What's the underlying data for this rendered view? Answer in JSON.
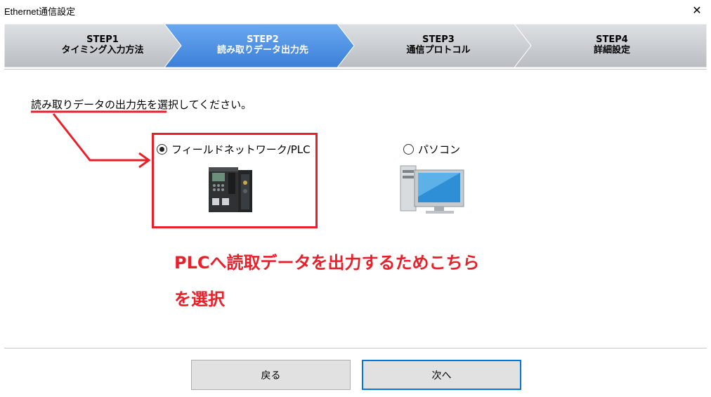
{
  "window": {
    "title": "Ethernet通信設定",
    "close_glyph": "✕"
  },
  "steps": [
    {
      "line1": "STEP1",
      "line2": "タイミング入力方法",
      "active": false
    },
    {
      "line1": "STEP2",
      "line2": "読み取りデータ出力先",
      "active": true
    },
    {
      "line1": "STEP3",
      "line2": "通信プロトコル",
      "active": false
    },
    {
      "line1": "STEP4",
      "line2": "詳細設定",
      "active": false
    }
  ],
  "instruction": "読み取りデータの出力先を選択してください。",
  "options": [
    {
      "label": "フィールドネットワーク/PLC",
      "selected": true,
      "icon": "plc-device-icon"
    },
    {
      "label": "パソコン",
      "selected": false,
      "icon": "desktop-pc-icon"
    }
  ],
  "annotation": {
    "line1": "PLCへ読取データを出力するためこちら",
    "line2": "を選択",
    "color": "#e8202a"
  },
  "buttons": {
    "back": "戻る",
    "next": "次へ"
  },
  "colors": {
    "active_step": "#4a8fe3",
    "inactive_step": "#c9cdd2",
    "accent": "#0078d7"
  }
}
